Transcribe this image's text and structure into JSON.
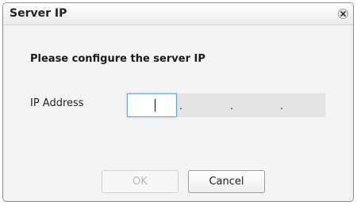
{
  "dialog": {
    "title": "Server IP",
    "heading": "Please configure the server IP"
  },
  "form": {
    "ip_label": "IP Address",
    "octets": [
      "",
      "",
      "",
      ""
    ],
    "separator": "."
  },
  "buttons": {
    "ok_label": "OK",
    "ok_enabled": false,
    "cancel_label": "Cancel"
  },
  "icons": {
    "close": "close-icon"
  },
  "colors": {
    "focus_border": "#6fa3d8",
    "field_background": "#e4e4e4"
  }
}
